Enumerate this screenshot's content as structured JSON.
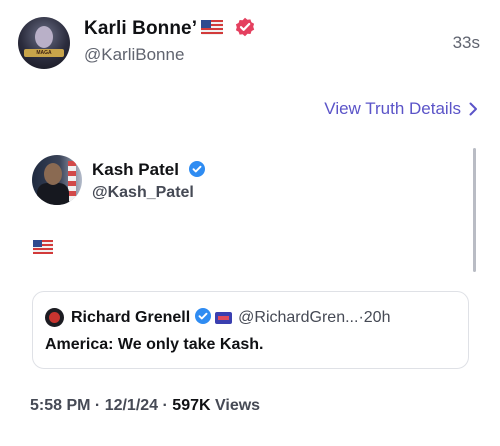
{
  "post": {
    "display_name": "Karli Bonne’",
    "handle": "@KarliBonne",
    "time_ago": "33s",
    "avatar_banner": "MAGA"
  },
  "details_link": {
    "label": "View Truth Details",
    "icon": "chevron-right-icon"
  },
  "embedded": {
    "display_name": "Kash Patel",
    "handle": "@Kash_Patel",
    "body_icon": "us-flag-icon"
  },
  "quote": {
    "display_name": "Richard Grenell",
    "handle": "@RichardGren...",
    "separator": " · ",
    "time": "20h",
    "text": "America: We only take Kash."
  },
  "footer": {
    "time": "5:58 PM",
    "date": "12/1/24",
    "separator": " · ",
    "views_count": "597K",
    "views_label": " Views"
  },
  "colors": {
    "link": "#5b54c8",
    "verified_pink": "#e4405f",
    "verified_blue": "#2f8cf2",
    "muted": "#60646f"
  }
}
